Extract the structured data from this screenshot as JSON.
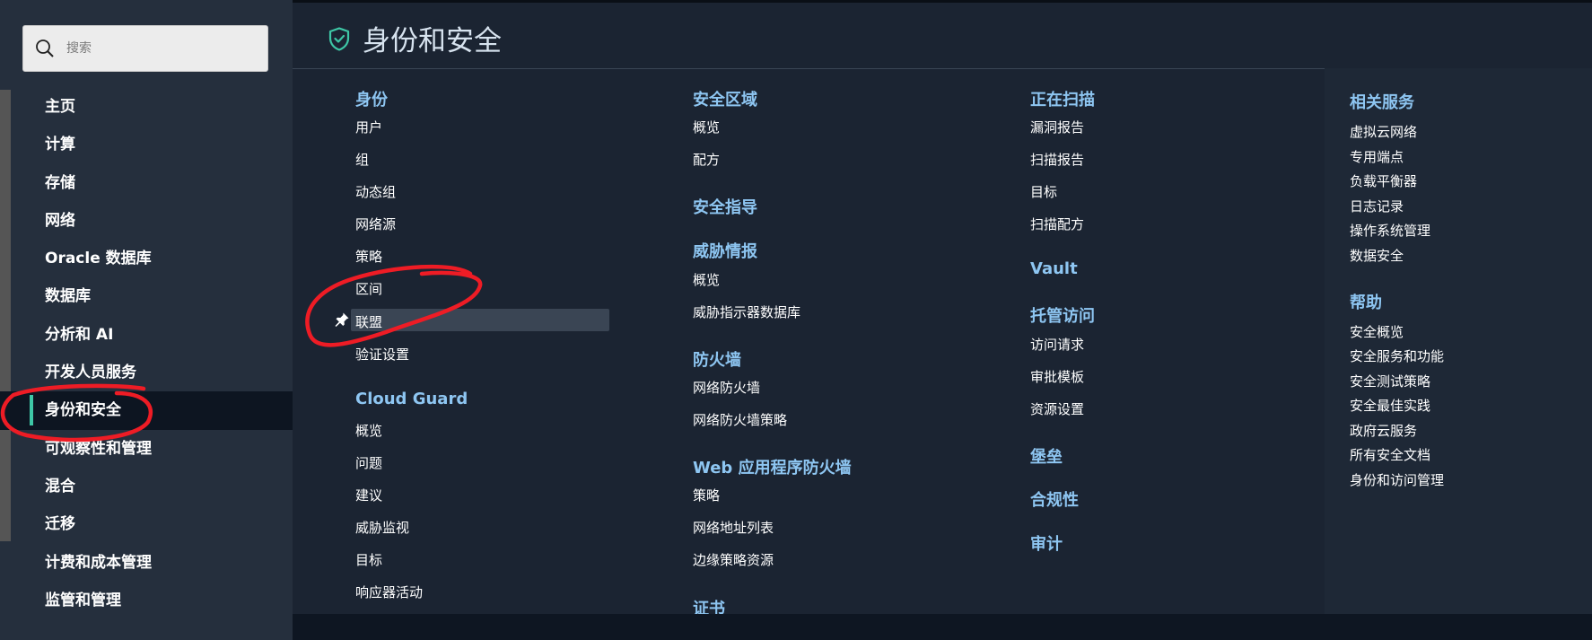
{
  "search": {
    "placeholder": "搜索"
  },
  "sidebar": {
    "items": [
      {
        "label": "主页"
      },
      {
        "label": "计算"
      },
      {
        "label": "存储"
      },
      {
        "label": "网络"
      },
      {
        "label": "Oracle 数据库"
      },
      {
        "label": "数据库"
      },
      {
        "label": "分析和 AI"
      },
      {
        "label": "开发人员服务"
      },
      {
        "label": "身份和安全"
      },
      {
        "label": "可观察性和管理"
      },
      {
        "label": "混合"
      },
      {
        "label": "迁移"
      },
      {
        "label": "计费和成本管理"
      },
      {
        "label": "监管和管理"
      }
    ]
  },
  "header": {
    "title": "身份和安全"
  },
  "col1": {
    "identity": {
      "title": "身份",
      "links": [
        "用户",
        "组",
        "动态组",
        "网络源",
        "策略",
        "区间",
        "联盟",
        "验证设置"
      ]
    },
    "cloud_guard": {
      "title": "Cloud Guard",
      "links": [
        "概览",
        "问题",
        "建议",
        "威胁监视",
        "目标",
        "响应器活动"
      ]
    }
  },
  "col2": {
    "security_zones": {
      "title": "安全区域",
      "links": [
        "概览",
        "配方"
      ]
    },
    "security_advisor": {
      "title": "安全指导"
    },
    "threat_intel": {
      "title": "威胁情报",
      "links": [
        "概览",
        "威胁指示器数据库"
      ]
    },
    "firewall": {
      "title": "防火墙",
      "links": [
        "网络防火墙",
        "网络防火墙策略"
      ]
    },
    "waf": {
      "title": "Web 应用程序防火墙",
      "links": [
        "策略",
        "网络地址列表",
        "边缘策略资源"
      ]
    },
    "certificates": {
      "title": "证书"
    }
  },
  "col3": {
    "scanning": {
      "title": "正在扫描",
      "links": [
        "漏洞报告",
        "扫描报告",
        "目标",
        "扫描配方"
      ]
    },
    "vault": {
      "title": "Vault"
    },
    "managed_access": {
      "title": "托管访问",
      "links": [
        "访问请求",
        "审批模板",
        "资源设置"
      ]
    },
    "bastion": {
      "title": "堡垒"
    },
    "compliance": {
      "title": "合规性"
    },
    "audit": {
      "title": "审计"
    }
  },
  "col4": {
    "related": {
      "title": "相关服务",
      "links": [
        "虚拟云网络",
        "专用端点",
        "负载平衡器",
        "日志记录",
        "操作系统管理",
        "数据安全"
      ]
    },
    "help": {
      "title": "帮助",
      "links": [
        "安全概览",
        "安全服务和功能",
        "安全测试策略",
        "安全最佳实践",
        "政府云服务",
        "所有安全文档",
        "身份和访问管理"
      ]
    }
  },
  "colors": {
    "accent": "#3ec7a6",
    "section_title": "#8ec6f2",
    "annotation": "#ee1c25"
  },
  "icons": {
    "search": "search-icon",
    "shield": "shield-check-icon",
    "pin": "pin-icon"
  }
}
